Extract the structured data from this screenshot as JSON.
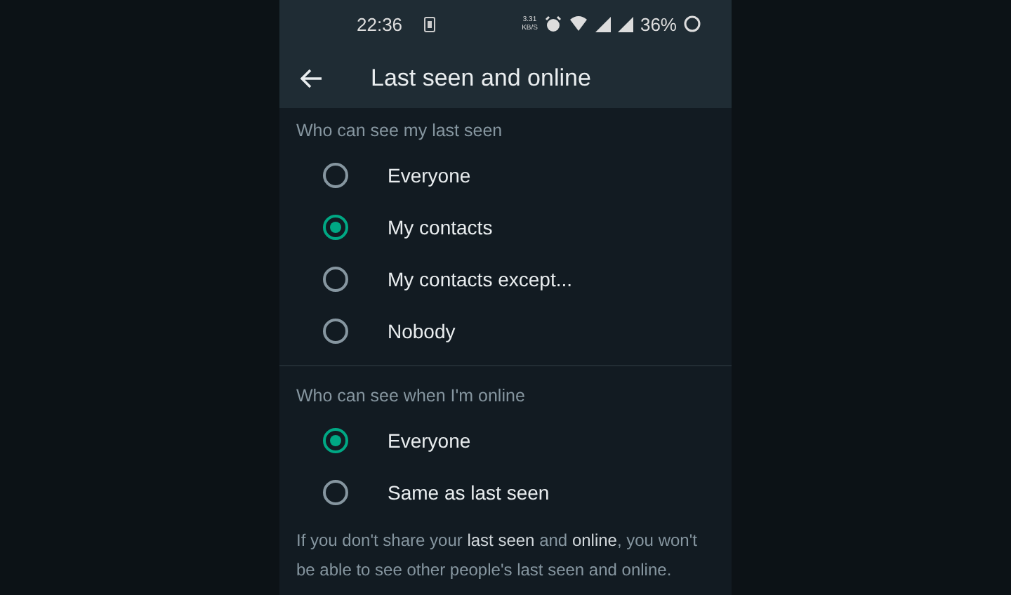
{
  "status_bar": {
    "time": "22:36",
    "net_speed": "3.31",
    "net_unit": "KB/S",
    "battery": "36%"
  },
  "app_bar": {
    "title": "Last seen and online"
  },
  "sections": [
    {
      "header": "Who can see my last seen",
      "options": [
        {
          "label": "Everyone",
          "selected": false
        },
        {
          "label": "My contacts",
          "selected": true
        },
        {
          "label": "My contacts except...",
          "selected": false
        },
        {
          "label": "Nobody",
          "selected": false
        }
      ]
    },
    {
      "header": "Who can see when I'm online",
      "options": [
        {
          "label": "Everyone",
          "selected": true
        },
        {
          "label": "Same as last seen",
          "selected": false
        }
      ]
    }
  ],
  "footer_note": "If you don't share your **last seen** and **online**, you won't be able to see other people's last seen and online."
}
